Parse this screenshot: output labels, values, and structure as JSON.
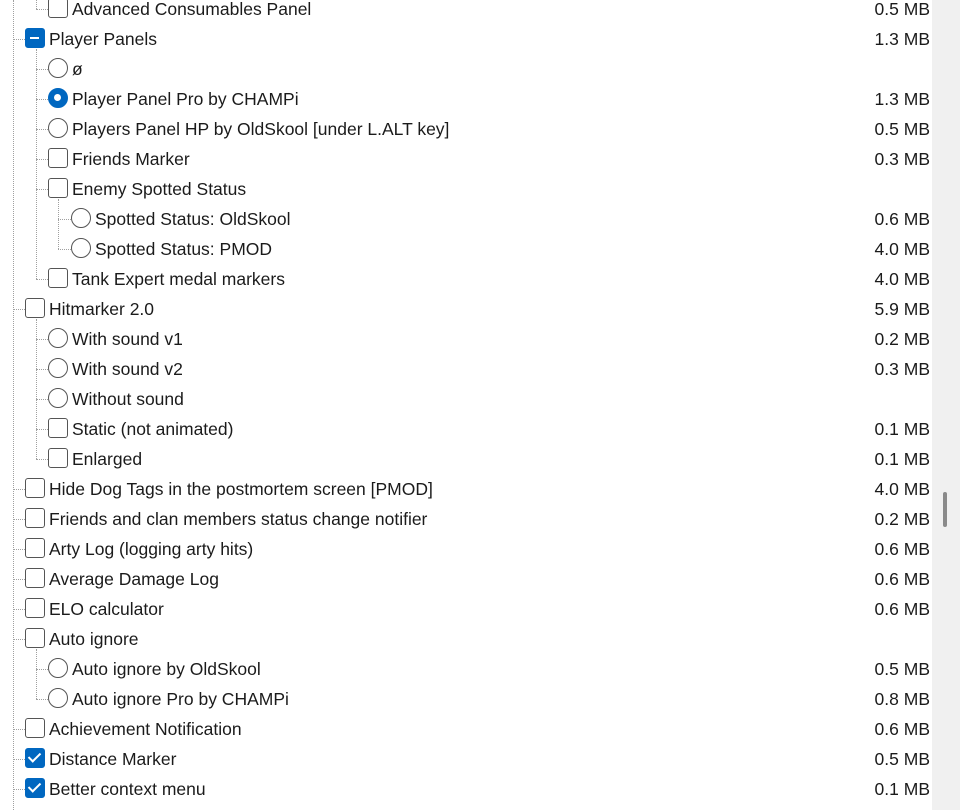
{
  "items": [
    {
      "label": "Advanced Consumables Panel",
      "size": "0.5 MB",
      "control": "checkbox",
      "state": "unchecked",
      "level": 1,
      "last": true
    },
    {
      "label": "Player Panels",
      "size": "1.3 MB",
      "control": "checkbox",
      "state": "partial",
      "level": 0,
      "last": false
    },
    {
      "label": "ø",
      "size": "",
      "control": "radio",
      "state": "unchecked",
      "level": 1,
      "last": false
    },
    {
      "label": "Player Panel Pro by CHAMPi",
      "size": "1.3 MB",
      "control": "radio",
      "state": "checked",
      "level": 1,
      "last": false
    },
    {
      "label": "Players Panel HP by OldSkool [under L.ALT key]",
      "size": "0.5 MB",
      "control": "radio",
      "state": "unchecked",
      "level": 1,
      "last": false
    },
    {
      "label": "Friends Marker",
      "size": "0.3 MB",
      "control": "checkbox",
      "state": "unchecked",
      "level": 1,
      "last": false
    },
    {
      "label": "Enemy Spotted Status",
      "size": "",
      "control": "checkbox",
      "state": "unchecked",
      "level": 1,
      "last": false
    },
    {
      "label": "Spotted Status: OldSkool",
      "size": "0.6 MB",
      "control": "radio",
      "state": "unchecked",
      "level": 2,
      "last": false
    },
    {
      "label": "Spotted Status: PMOD",
      "size": "4.0 MB",
      "control": "radio",
      "state": "unchecked",
      "level": 2,
      "last": true
    },
    {
      "label": "Tank Expert medal markers",
      "size": "4.0 MB",
      "control": "checkbox",
      "state": "unchecked",
      "level": 1,
      "last": true
    },
    {
      "label": "Hitmarker 2.0",
      "size": "5.9 MB",
      "control": "checkbox",
      "state": "unchecked",
      "level": 0,
      "last": false
    },
    {
      "label": "With sound v1",
      "size": "0.2 MB",
      "control": "radio",
      "state": "unchecked",
      "level": 1,
      "last": false
    },
    {
      "label": "With sound v2",
      "size": "0.3 MB",
      "control": "radio",
      "state": "unchecked",
      "level": 1,
      "last": false
    },
    {
      "label": "Without sound",
      "size": "",
      "control": "radio",
      "state": "unchecked",
      "level": 1,
      "last": false
    },
    {
      "label": "Static (not animated)",
      "size": "0.1 MB",
      "control": "checkbox",
      "state": "unchecked",
      "level": 1,
      "last": false
    },
    {
      "label": "Enlarged",
      "size": "0.1 MB",
      "control": "checkbox",
      "state": "unchecked",
      "level": 1,
      "last": true
    },
    {
      "label": "Hide Dog Tags in the postmortem screen [PMOD]",
      "size": "4.0 MB",
      "control": "checkbox",
      "state": "unchecked",
      "level": 0,
      "last": false
    },
    {
      "label": "Friends and clan members status change notifier",
      "size": "0.2 MB",
      "control": "checkbox",
      "state": "unchecked",
      "level": 0,
      "last": false
    },
    {
      "label": "Arty Log (logging arty hits)",
      "size": "0.6 MB",
      "control": "checkbox",
      "state": "unchecked",
      "level": 0,
      "last": false
    },
    {
      "label": "Average Damage Log",
      "size": "0.6 MB",
      "control": "checkbox",
      "state": "unchecked",
      "level": 0,
      "last": false
    },
    {
      "label": "ELO calculator",
      "size": "0.6 MB",
      "control": "checkbox",
      "state": "unchecked",
      "level": 0,
      "last": false
    },
    {
      "label": "Auto ignore",
      "size": "",
      "control": "checkbox",
      "state": "unchecked",
      "level": 0,
      "last": false
    },
    {
      "label": "Auto ignore by OldSkool",
      "size": "0.5 MB",
      "control": "radio",
      "state": "unchecked",
      "level": 1,
      "last": false
    },
    {
      "label": "Auto ignore Pro by CHAMPi",
      "size": "0.8 MB",
      "control": "radio",
      "state": "unchecked",
      "level": 1,
      "last": true
    },
    {
      "label": "Achievement Notification",
      "size": "0.6 MB",
      "control": "checkbox",
      "state": "unchecked",
      "level": 0,
      "last": false
    },
    {
      "label": "Distance Marker",
      "size": "0.5 MB",
      "control": "checkbox",
      "state": "checked",
      "level": 0,
      "last": false
    },
    {
      "label": "Better context menu",
      "size": "0.1 MB",
      "control": "checkbox",
      "state": "checked",
      "level": 0,
      "last": false
    }
  ],
  "scrollbar": {
    "position": 0.62
  }
}
